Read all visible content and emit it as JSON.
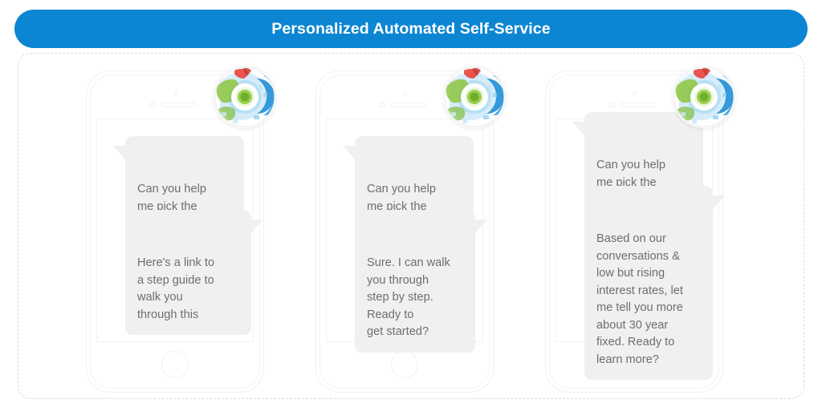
{
  "header": {
    "title": "Personalized Automated Self-Service",
    "background_color": "#0c86d2",
    "text_color": "#ffffff"
  },
  "panel": {
    "border_style": "dashed",
    "border_color": "#dcdcdc"
  },
  "bubble_style": {
    "background_color": "#f0f0f0",
    "text_color": "#6e6e6e"
  },
  "avatar": {
    "icon_name": "eye-logo-icon",
    "colors": {
      "ring_blue": "#2e9fe0",
      "deep_blue": "#1f7fcd",
      "pale_blue": "#bfe3f7",
      "green": "#8cc63f",
      "dark_green": "#5aa12b",
      "red": "#e8453c",
      "white": "#ffffff"
    }
  },
  "phones": [
    {
      "name": "phone-one",
      "messages": [
        {
          "id": "p1-m1",
          "side": "left",
          "text": "Can you help\nme pick the\nright Insurance?"
        },
        {
          "id": "p1-m2",
          "side": "right",
          "text": "Here's a link to\na step guide to\nwalk you\nthrough this"
        }
      ]
    },
    {
      "name": "phone-two",
      "messages": [
        {
          "id": "p2-m1",
          "side": "left",
          "text": "Can you help\nme pick the\nright Insurance?"
        },
        {
          "id": "p2-m2",
          "side": "right",
          "text": "Sure. I can walk\nyou through\nstep by step.\nReady to\nget started?"
        }
      ]
    },
    {
      "name": "phone-three",
      "messages": [
        {
          "id": "p3-m1",
          "side": "left",
          "text": "Can you help\nme pick the\nright Insurance?"
        },
        {
          "id": "p3-m2",
          "side": "right",
          "text": "Based on our\nconversations &\nlow but rising\ninterest rates, let\nme tell you more\nabout 30 year\nfixed. Ready to\nlearn more?"
        }
      ]
    }
  ]
}
